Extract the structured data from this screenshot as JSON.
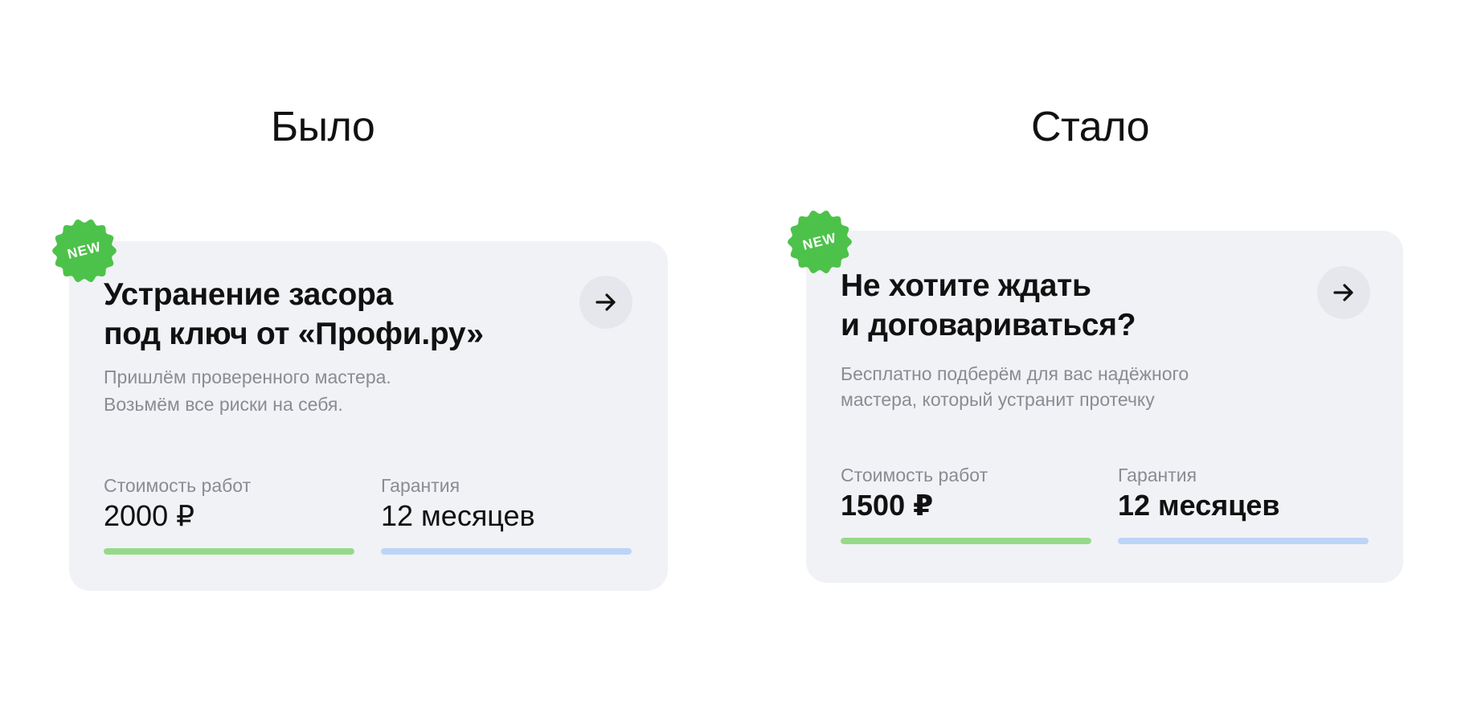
{
  "colors": {
    "card_background": "#f1f2f6",
    "badge_green": "#4dc24a",
    "price_bar": "#96d98a",
    "warranty_bar": "#bcd4f7",
    "arrow_button_bg": "#e6e7ec"
  },
  "before": {
    "heading": "Было",
    "card": {
      "badge": "NEW",
      "title_line1": "Устранение засора",
      "title_line2": "под ключ от «Профи.ру»",
      "desc_line1": "Пришлём проверенного мастера.",
      "desc_line2": "Возьмём все риски на себя.",
      "arrow_icon": "arrow-right-icon",
      "price": {
        "label": "Стоимость работ",
        "value": "2000 ₽",
        "bar_fraction": 1.0
      },
      "warranty": {
        "label": "Гарантия",
        "value": "12 месяцев",
        "bar_fraction": 1.0
      }
    }
  },
  "after": {
    "heading": "Стало",
    "card": {
      "badge": "NEW",
      "title_line1": "Не хотите ждать",
      "title_line2": "и договариваться?",
      "desc_line1": "Бесплатно подберём для вас надёжного",
      "desc_line2": "мастера, который устранит протечку",
      "arrow_icon": "arrow-right-icon",
      "price": {
        "label": "Стоимость работ",
        "value": "1500 ₽",
        "bar_fraction": 1.0
      },
      "warranty": {
        "label": "Гарантия",
        "value": "12 месяцев",
        "bar_fraction": 1.0
      }
    }
  }
}
